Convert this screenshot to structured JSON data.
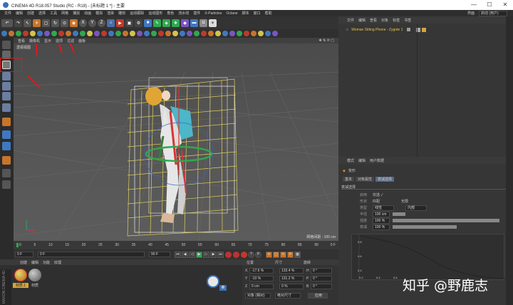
{
  "window": {
    "title": "CINEMA 4D R18.057 Studio (RC - R18) - [未标题 1 *] - 主要",
    "min": "—",
    "max": "☐",
    "close": "✕"
  },
  "menu": [
    "文件",
    "编辑",
    "创建",
    "选择",
    "工具",
    "网格",
    "捕捉",
    "动画",
    "模拟",
    "渲染",
    "雕刻",
    "运动跟踪",
    "运动图形",
    "角色",
    "流水线",
    "插件",
    "X-Particles",
    "Octane",
    "脚本",
    "窗口",
    "帮助"
  ],
  "layout": {
    "label": "界面",
    "value": "启动 (用户)"
  },
  "toolbar_letters": [
    "X",
    "Y",
    "Z"
  ],
  "viewport": {
    "menu": [
      "查看",
      "摄像机",
      "显示",
      "选项",
      "过滤",
      "面板"
    ],
    "label": "透视视图",
    "grid_spacing": "网格间距 : 100 cm"
  },
  "timeline": {
    "ticks": [
      "0",
      "5",
      "10",
      "15",
      "20",
      "25",
      "30",
      "35",
      "40",
      "45",
      "50",
      "55",
      "60",
      "65",
      "70",
      "75",
      "80",
      "85",
      "90"
    ],
    "end": "0 F"
  },
  "controls": {
    "start": "0 F",
    "end": "90 F",
    "current": "0 F",
    "end2": "90 F"
  },
  "materials": {
    "menu": [
      "创建",
      "编辑",
      "功能",
      "纹理"
    ],
    "items": [
      "材质.1",
      "材质"
    ]
  },
  "coords": {
    "tabs": [
      "位置",
      "尺寸",
      "旋转"
    ],
    "x_label": "X",
    "x_val": "-17.6 %",
    "x_val2": "133.4 %",
    "x_h": "H",
    "x_h_val": "0 °",
    "y_label": "Y",
    "y_val": "-10 %",
    "y_val2": "131.2 %",
    "y_p": "P",
    "y_p_val": "0 °",
    "z_label": "Z",
    "z_val": "0 cm",
    "z_val2": "0 %",
    "z_b": "B",
    "z_b_val": "0 °",
    "mode1": "对象 (相对)",
    "mode2": "绝对尺寸",
    "apply": "应用"
  },
  "objects": {
    "menu": [
      "文件",
      "编辑",
      "查看",
      "对象",
      "标签",
      "书签"
    ],
    "item": "Woman Sitting Phone - Zygote 1"
  },
  "attributes": {
    "menu": [
      "模式",
      "编辑",
      "用户数据"
    ],
    "title": "变形",
    "tabs": [
      "基本",
      "对象属性",
      "衰减选择"
    ],
    "section": "衰减选择",
    "rows": [
      {
        "label": "启用",
        "value": "仅选 ✓"
      },
      {
        "label": "形状",
        "value": "匹配",
        "extra": "无限"
      },
      {
        "label": "类型",
        "value": "线性",
        "extra": "内部"
      },
      {
        "label": "半径",
        "value": "100 cm"
      },
      {
        "label": "强度",
        "value": "100 %"
      },
      {
        "label": "衰减",
        "value": "100 %"
      }
    ],
    "graph_labels": [
      "0.8",
      "0.6",
      "0.4",
      "0.2",
      "0.0",
      "0.2",
      "0.4",
      "0.6",
      "0.8"
    ]
  },
  "help": "英",
  "brand": "MAXON CINEMA 4D",
  "watermark": "知乎 @野鹿志",
  "colors": {
    "highlight": "#e0181b",
    "bbox": "#e0d05a",
    "accent_green": "#2fa84f",
    "accent_orange": "#e08a1e"
  }
}
